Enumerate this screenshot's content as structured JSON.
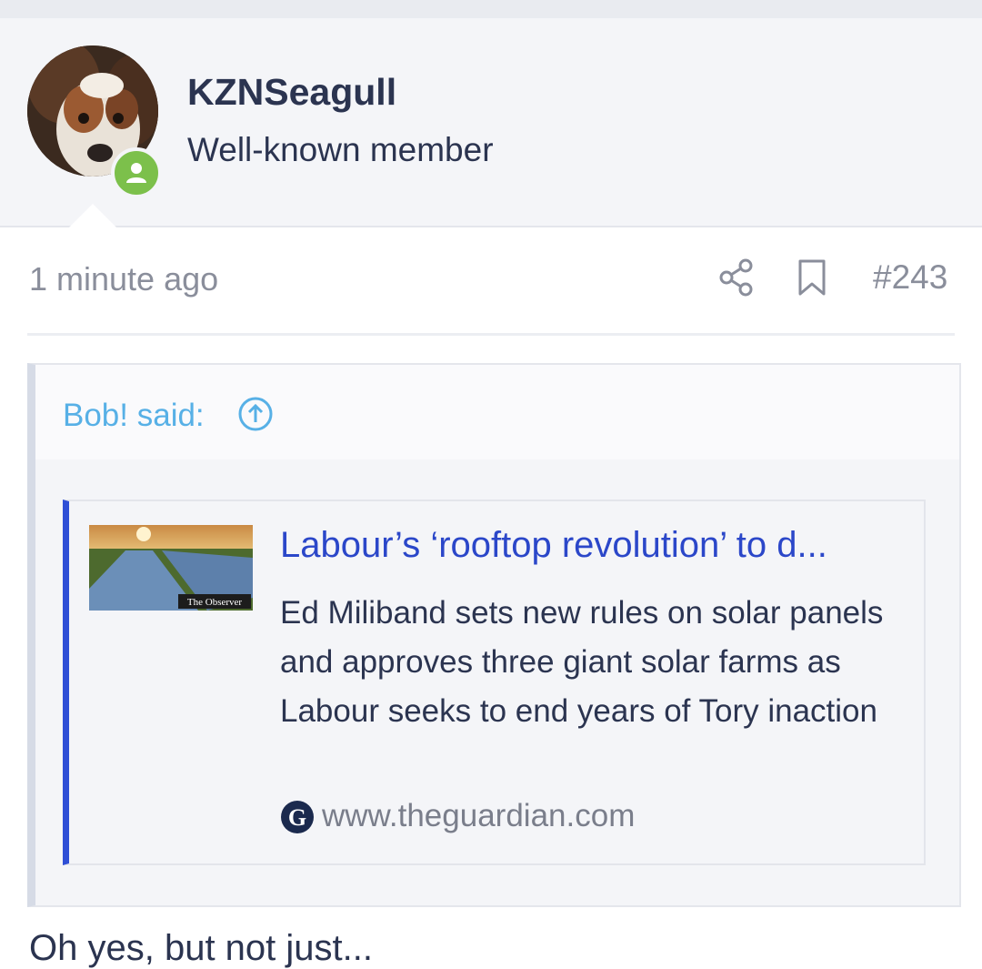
{
  "user": {
    "name": "KZNSeagull",
    "title": "Well-known member"
  },
  "post": {
    "timestamp": "1 minute ago",
    "number": "#243"
  },
  "quote": {
    "author": "Bob! said:",
    "link_card": {
      "title": "Labour’s ‘rooftop revolution’ to d...",
      "description": "Ed Miliband sets new rules on solar panels and approves three giant solar farms as Labour seeks to end years of Tory inaction",
      "domain": "www.theguardian.com",
      "thumbnail_brand": "The Observer"
    }
  },
  "next_line": "Oh yes, but not just...",
  "icons": {
    "online": "person-online-icon",
    "share": "share-icon",
    "bookmark": "bookmark-icon",
    "quote_jump": "arrow-up-circle-icon",
    "domain": "guardian-logo-icon"
  },
  "colors": {
    "accent_link": "#2b47c9",
    "quote_author": "#57b0e6",
    "online_badge": "#7cc04b",
    "text": "#2b3450",
    "muted": "#8a8e9b"
  }
}
